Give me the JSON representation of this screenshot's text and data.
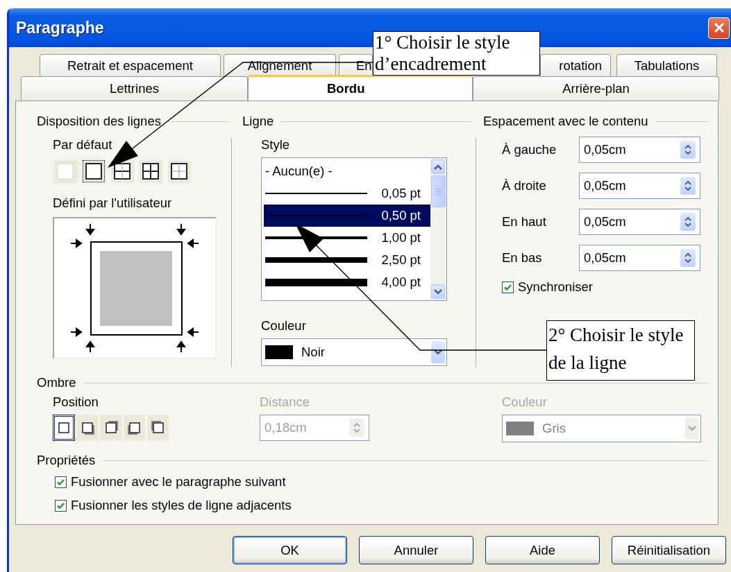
{
  "window": {
    "title": "Paragraphe"
  },
  "tab_rows": [
    [
      {
        "label": "Retrait et espacement",
        "selected": false
      },
      {
        "label": "Alignement",
        "selected": false
      },
      {
        "label": "En",
        "selected": false
      },
      {
        "label": "rotation",
        "selected": false
      },
      {
        "label": "Tabulations",
        "selected": false
      }
    ],
    [
      {
        "label": "Lettrines",
        "selected": false
      },
      {
        "label": "Bordu",
        "selected": true
      },
      {
        "label": "Arrière-plan",
        "selected": false
      }
    ]
  ],
  "line_arrangement": {
    "title": "Disposition des lignes",
    "default_label": "Par défaut",
    "presets": [
      {
        "kind": "none",
        "selected": false
      },
      {
        "kind": "outer",
        "selected": true
      },
      {
        "kind": "outer-h",
        "selected": false
      },
      {
        "kind": "outer-hv",
        "selected": false
      },
      {
        "kind": "thin-hv",
        "selected": false
      }
    ],
    "user_label": "Défini par l'utilisateur"
  },
  "line": {
    "title": "Ligne",
    "style_label": "Style",
    "styles": [
      {
        "label": "- Aucun(e) -",
        "kind": "none",
        "selected": false
      },
      {
        "label": "0,05 pt",
        "kind": "hairline",
        "selected": false
      },
      {
        "label": "0,50 pt",
        "kind": "thin",
        "selected": true
      },
      {
        "label": "1,00 pt",
        "kind": "medium",
        "selected": false
      },
      {
        "label": "2,50 pt",
        "kind": "thick",
        "selected": false
      },
      {
        "label": "4,00 pt",
        "kind": "heavy",
        "selected": false
      }
    ],
    "color_label": "Couleur",
    "color": {
      "value": "Noir",
      "color": "#000000"
    }
  },
  "spacing": {
    "title": "Espacement avec le contenu",
    "fields": [
      {
        "label": "À gauche",
        "value": "0,05cm"
      },
      {
        "label": "À droite",
        "value": "0,05cm"
      },
      {
        "label": "En haut",
        "value": "0,05cm"
      },
      {
        "label": "En bas",
        "value": "0,05cm"
      }
    ],
    "synchronize": {
      "label": "Synchroniser",
      "checked": true
    }
  },
  "shadow": {
    "title": "Ombre",
    "position_label": "Position",
    "positions": [
      {
        "kind": "none",
        "selected": true
      },
      {
        "kind": "bottom-right",
        "selected": false
      },
      {
        "kind": "top-right",
        "selected": false
      },
      {
        "kind": "bottom-left",
        "selected": false
      },
      {
        "kind": "top-left",
        "selected": false
      }
    ],
    "distance": {
      "label": "Distance",
      "value": "0,18cm",
      "disabled": true
    },
    "color": {
      "label": "Couleur",
      "value": "Gris",
      "color": "#808080",
      "disabled": true
    }
  },
  "properties": {
    "title": "Propriétés",
    "options": [
      {
        "label": "Fusionner avec le paragraphe suivant",
        "checked": true
      },
      {
        "label": "Fusionner les styles de ligne adjacents",
        "checked": true
      }
    ]
  },
  "buttons": [
    {
      "label": "OK",
      "default": true
    },
    {
      "label": "Annuler",
      "default": false
    },
    {
      "label": "Aide",
      "default": false
    },
    {
      "label": "Réinitialisation",
      "default": false
    }
  ],
  "annotations": [
    {
      "lines": [
        "1° Choisir le style",
        "d’encadrement"
      ]
    },
    {
      "lines": [
        "2° Choisir le style",
        "de la ligne"
      ]
    }
  ]
}
